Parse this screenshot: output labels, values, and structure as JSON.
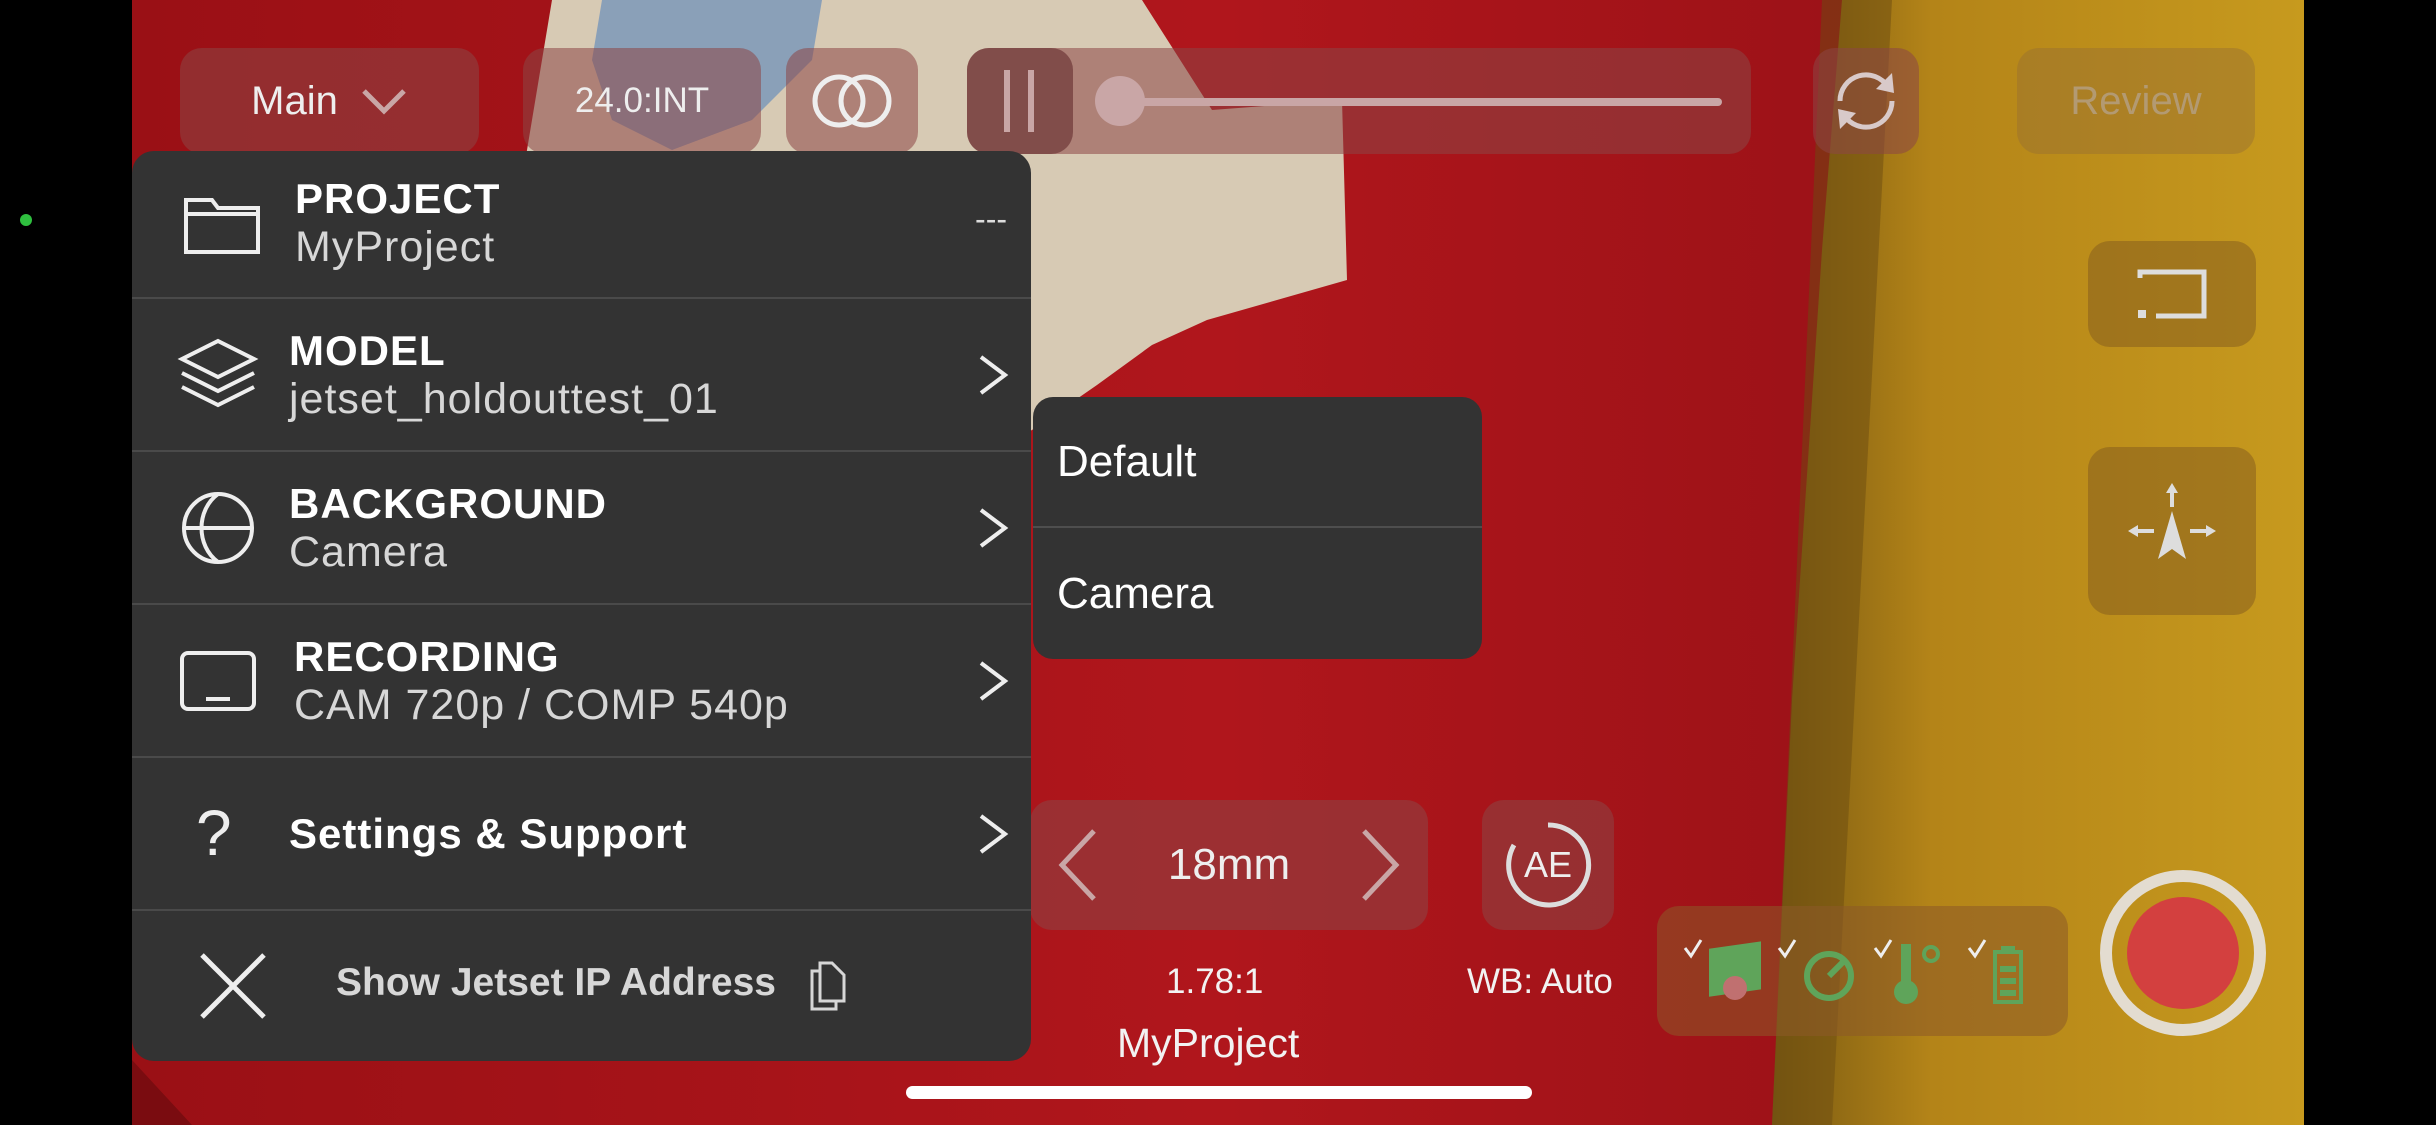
{
  "topbar": {
    "camera_selector": "Main",
    "framerate": "24.0:INT",
    "review_label": "Review"
  },
  "menu": {
    "project": {
      "title": "PROJECT",
      "value": "MyProject",
      "extra": "---"
    },
    "model": {
      "title": "MODEL",
      "value": "jetset_holdouttest_01"
    },
    "background": {
      "title": "BACKGROUND",
      "value": "Camera"
    },
    "recording": {
      "title": "RECORDING",
      "value": "CAM 720p / COMP 540p"
    },
    "settings": {
      "title": "Settings & Support"
    },
    "ip_address": {
      "label": "Show Jetset IP Address"
    }
  },
  "submenu": {
    "items": [
      "Default",
      "Camera"
    ]
  },
  "lens": {
    "focal_length": "18mm",
    "ae_label": "AE"
  },
  "status": {
    "aspect_ratio": "1.78:1",
    "white_balance": "WB: Auto",
    "project_name": "MyProject"
  },
  "colors": {
    "scene_red": "#a8141a",
    "panel": "#333333",
    "record_red": "#d3403f",
    "status_green": "#5fa45a",
    "yellow_wall": "#b98a1c"
  },
  "icons": [
    "folder-icon",
    "layers-icon",
    "globe-icon",
    "monitor-icon",
    "question-icon",
    "close-icon",
    "copy-icon",
    "dual-circle-icon",
    "sync-icon",
    "cast-icon",
    "tracking-icon",
    "record-icon"
  ]
}
